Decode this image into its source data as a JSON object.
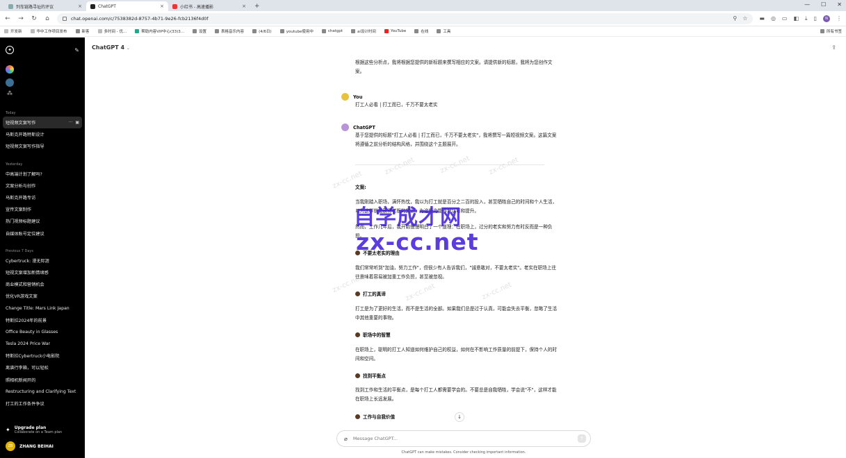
{
  "browser": {
    "tabs": [
      {
        "title": "列车链路寻址的评议",
        "active": false
      },
      {
        "title": "ChatGPT",
        "active": true
      },
      {
        "title": "小红书 - 高速播影",
        "active": false
      }
    ],
    "new_tab": "+",
    "window_controls": [
      "—",
      "☐",
      "✕"
    ],
    "url": "chat.openai.com/c/7538382d-8757-4b71-9e26-fcb2136f4d0f",
    "profile_initial": "N"
  },
  "bookmarks": {
    "items": [
      "开发新",
      "华中工作项目发布",
      "新客",
      "多时间 - 优...",
      "帮助内容VIP中心(33)3...",
      "设置",
      "表格音乐内容",
      "(4/6日)",
      "youtube使用中",
      "chatgpt",
      "ai设计时间",
      "YouTube",
      "在线",
      "工具"
    ],
    "right": "所有书签"
  },
  "sidebar": {
    "sections": [
      {
        "label": "Today",
        "items": [
          "短视频文案写作",
          "马斯克开路特斯设计",
          "短视频文案写作指导"
        ]
      },
      {
        "label": "Yesterday",
        "items": [
          "中高端计划了解吗?",
          "文案分析与创作",
          "马斯克开路专访",
          "宣传文案制作",
          "热门视频标题建议",
          "自媒体账号定位建议"
        ]
      },
      {
        "label": "Previous 7 Days",
        "items": [
          "Cybertruck: 漫无际涯",
          "短视文案增加新情绪感",
          "商业模式和营销机会",
          "优化VR游戏文案",
          "Change Title: Mars Link Japan",
          "特斯拉2024年的前景",
          "Office Beauty in Glasses",
          "Tesla 2024 Price War",
          "特斯拉Cybertruck小电影院",
          "离谱行李箱，可以轻松",
          "照相机新闻开的",
          "Restructuring and Clarifying Text",
          "打工的工作条件争议"
        ]
      }
    ],
    "upgrade_title": "Upgrade plan",
    "upgrade_sub": "Collaborate on a Team plan",
    "user_name": "ZHANG BEIHAI",
    "user_initials": "ZB"
  },
  "header": {
    "model": "ChatGPT 4",
    "chevron": "⌄"
  },
  "chat": {
    "prev_tail": "根据这些分析点，我将根据您提供的新标题来撰写相应的文案。请提供新的标题，我将为您创作文案。",
    "user_name": "You",
    "user_message": "打工人必看 | 打工而已，千万不要太老实",
    "assistant_name": "ChatGPT",
    "assistant_intro": "基于您提供的标题\"打工人必看 | 打工而已，千万不要太老实\"，我将撰写一篇短视频文案。这篇文案将遵循之前分析的结构风格，并围绕这个主题展开。",
    "doc_label": "文案:",
    "p1": "当我刚踏入职场，满怀热忱，我以为打工就是百分之二百的投入，甚至牺牲自己的时间和个人生活，以为这样就能获得老板的赏识，为这努力能得到认可和提升。",
    "p2": "然而，工作几年后，我开始慢慢明白了一个道理：在职场上，过分的老实和努力有时反而是一种负担。",
    "h1": "不要太老实的理由",
    "p3": "我们常常听到\"加油，努力工作\"，但很少有人告诉我们，\"诚意敢对，不要太老实\"。老实在职场上往往意味着容易被加重工作负担，甚至被忽视。",
    "h2": "打工的真谛",
    "p4": "打工是为了更好的生活，而不是生活的全部。如果我们总是过于认真，可能会失去平衡，忽略了生活中其他重要的事物。",
    "h3": "职场中的智慧",
    "p5": "在职场上，聪明的打工人知道如何维护自己的权益，如何在不影响工作质量的前提下，保持个人的时间和空间。",
    "h4": "找到平衡点",
    "p6": "找到工作和生活的平衡点，是每个打工人都需要学会的。不要总是自我牺牲，学会说\"不\"，这样才能在职场上长远发展。",
    "h5": "工作与自我价值"
  },
  "composer": {
    "placeholder": "Message ChatGPT...",
    "disclaimer": "ChatGPT can make mistakes. Consider checking important information."
  },
  "watermark": {
    "line1": "自学成才网",
    "line2": "zx-cc.net",
    "faint": "zx-cc.net"
  },
  "colors": {
    "sidebar_bg": "#000000",
    "watermark": "#3f1bd6",
    "user_avatar": "#e8c23a",
    "gpt_avatar": "#b895d8"
  }
}
